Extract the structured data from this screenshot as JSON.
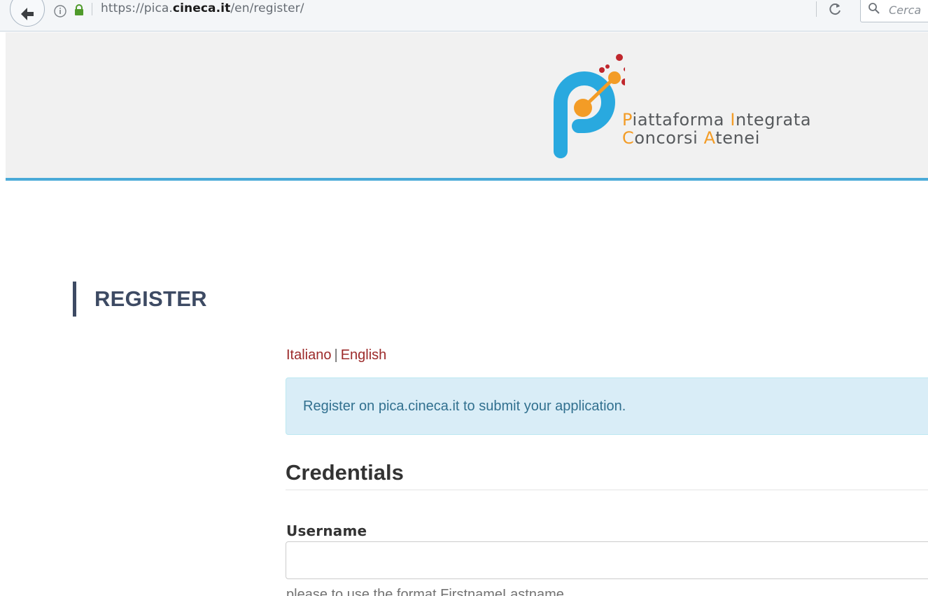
{
  "browser": {
    "url_prefix": "https://pica.",
    "url_domain": "cineca.it",
    "url_path": "/en/register/",
    "search_placeholder": "Cerca",
    "icons": [
      "back-arrow-icon",
      "info-icon",
      "lock-icon",
      "reload-icon",
      "search-icon"
    ]
  },
  "header": {
    "logo_line1": "Piattaforma Integrata",
    "logo_line2": "Concorsi Atenei",
    "colors": {
      "background": "#f1f1f1",
      "rule": "#4aaad8",
      "logo_blue": "#29a9df",
      "logo_orange": "#f39c26",
      "logo_red": "#c0272d"
    }
  },
  "page": {
    "title": "REGISTER",
    "lang_it": "Italiano",
    "lang_sep": "|",
    "lang_en": "English",
    "alert_text": "Register on pica.cineca.it to submit your application.",
    "section_title": "Credentials",
    "username_label": "Username",
    "username_value": "",
    "username_help": "please to use the format FirstnameLastname"
  }
}
